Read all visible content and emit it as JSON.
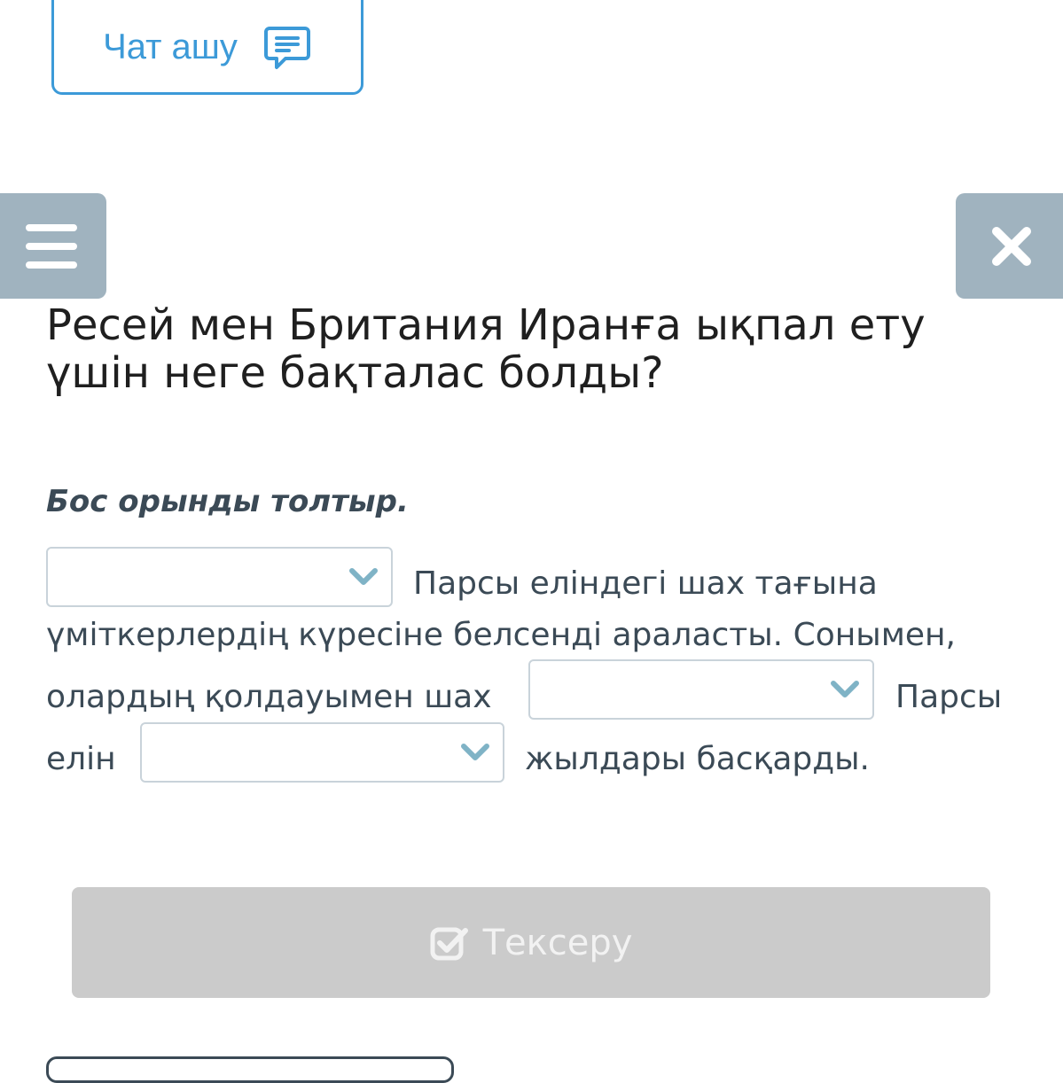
{
  "chat": {
    "label": "Чат ашу",
    "icon": "chat-bubble-icon"
  },
  "menu_icon": "hamburger-icon",
  "close_icon": "close-icon",
  "question": {
    "line1": "Ресей мен Британия Иранға ықпал ету",
    "line2": "үшін неге бақталас болды?"
  },
  "instruction": "Бос орынды толтыр.",
  "passage": {
    "seg1": "Парсы еліндегі шах тағына",
    "seg2": "үміткерлердің күресіне белсенді араласты. Сонымен,",
    "seg3": "олардың қолдауымен шах",
    "seg4": "Парсы",
    "seg5": "елін",
    "seg6": "жылдары басқарды."
  },
  "blanks": [
    "",
    "",
    ""
  ],
  "check_button": {
    "label": "Тексеру",
    "icon": "check-square-icon"
  },
  "colors": {
    "accent": "#3c9ad8",
    "side_buttons": "#a0b3bf",
    "disabled_button": "#cbcbcb",
    "chevron": "#7fb3c6"
  }
}
